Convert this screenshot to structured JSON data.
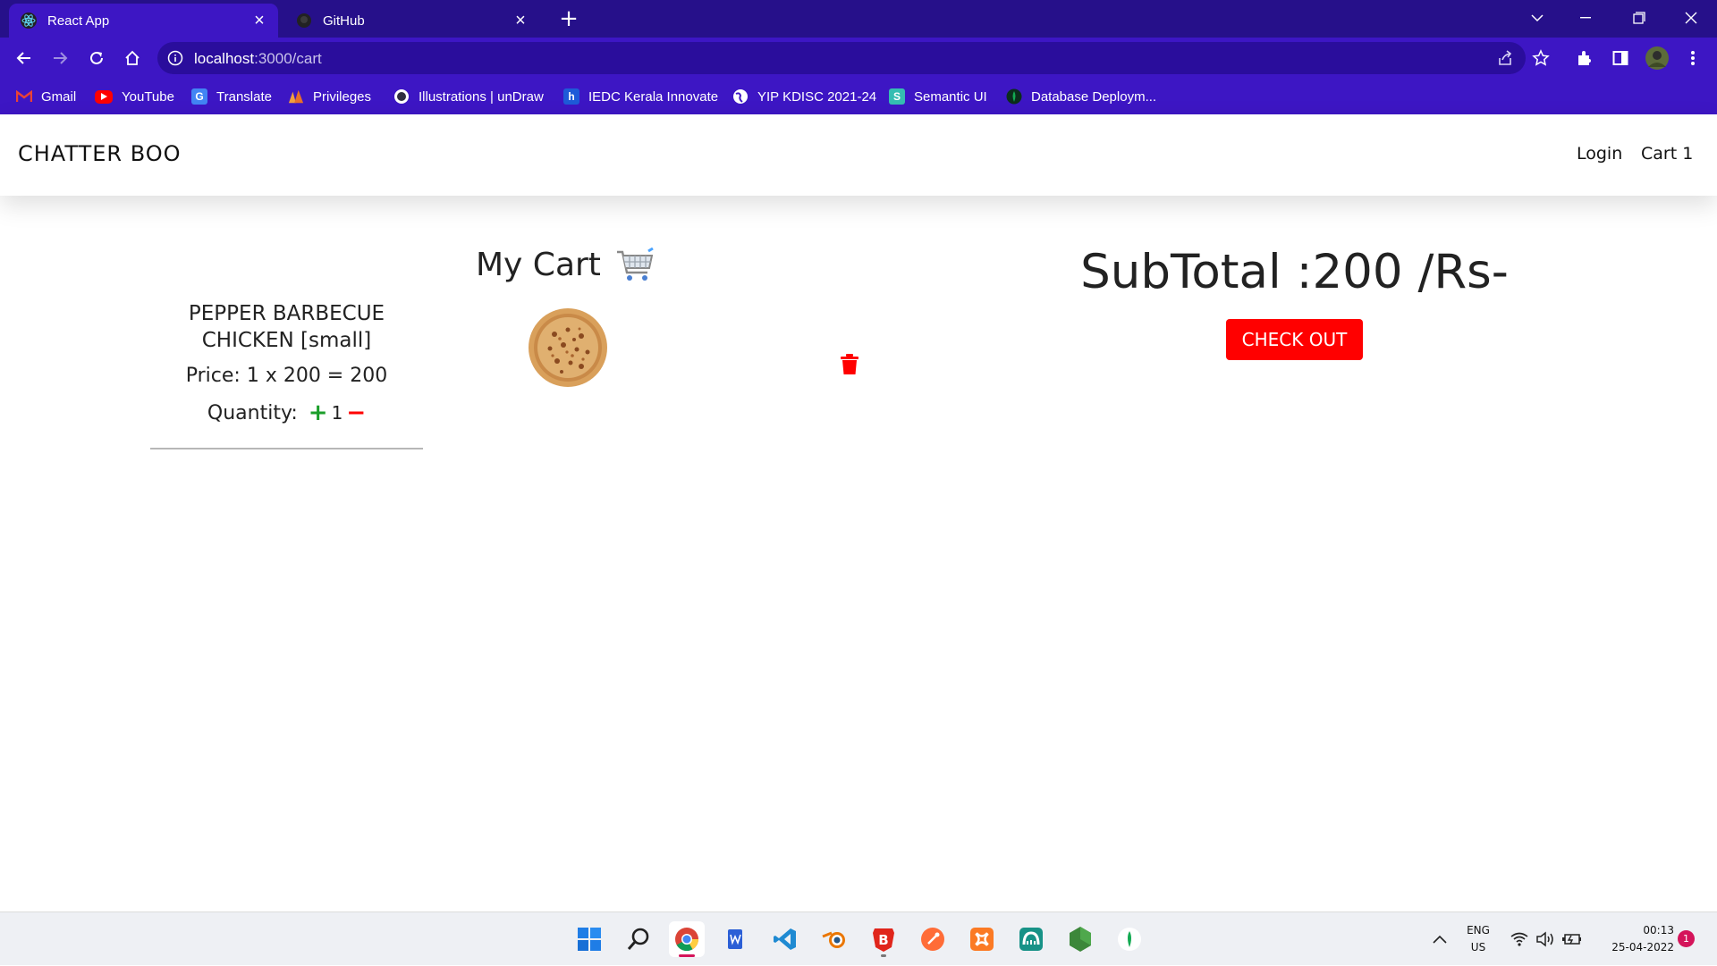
{
  "browser": {
    "tabs": [
      {
        "title": "React App",
        "icon": "react-icon",
        "active": true
      },
      {
        "title": "GitHub",
        "icon": "github-icon",
        "active": false
      }
    ],
    "url_host": "localhost",
    "url_path": ":3000/cart",
    "bookmarks": [
      {
        "label": "Gmail",
        "icon": "gmail-icon"
      },
      {
        "label": "YouTube",
        "icon": "youtube-icon"
      },
      {
        "label": "Translate",
        "icon": "translate-icon"
      },
      {
        "label": "Privileges",
        "icon": "privileges-icon"
      },
      {
        "label": "Illustrations | unDraw",
        "icon": "undraw-icon"
      },
      {
        "label": "IEDC Kerala Innovate",
        "icon": "iedc-icon"
      },
      {
        "label": "YIP KDISC 2021-24",
        "icon": "globe-icon"
      },
      {
        "label": "Semantic UI",
        "icon": "semantic-ui-icon"
      },
      {
        "label": "Database Deploym...",
        "icon": "mongodb-icon"
      }
    ],
    "colors": {
      "chrome": "#3d16c4",
      "tabstrip": "#26108a"
    }
  },
  "navbar": {
    "brand": "CHATTER BOO",
    "login": "Login",
    "cart": "Cart 1"
  },
  "cart": {
    "title": "My Cart",
    "items": [
      {
        "name": "PEPPER BARBECUE CHICKEN [small]",
        "price_line": "Price: 1 x 200 = 200",
        "quantity_label": "Quantity:",
        "quantity": "1"
      }
    ],
    "subtotal": "SubTotal :200 /Rs-",
    "checkout": "CHECK OUT",
    "accent": "#ff0000"
  },
  "taskbar": {
    "apps": [
      "windows-start-icon",
      "search-icon",
      "chrome-icon",
      "wps-icon",
      "vscode-icon",
      "blender-icon",
      "brave-icon",
      "postman-icon",
      "xampp-icon",
      "gitkraken-icon",
      "nodejs-icon",
      "mongodb-compass-icon"
    ],
    "lang_line1": "ENG",
    "lang_line2": "US",
    "time": "00:13",
    "date": "25-04-2022",
    "notifications": "1"
  }
}
